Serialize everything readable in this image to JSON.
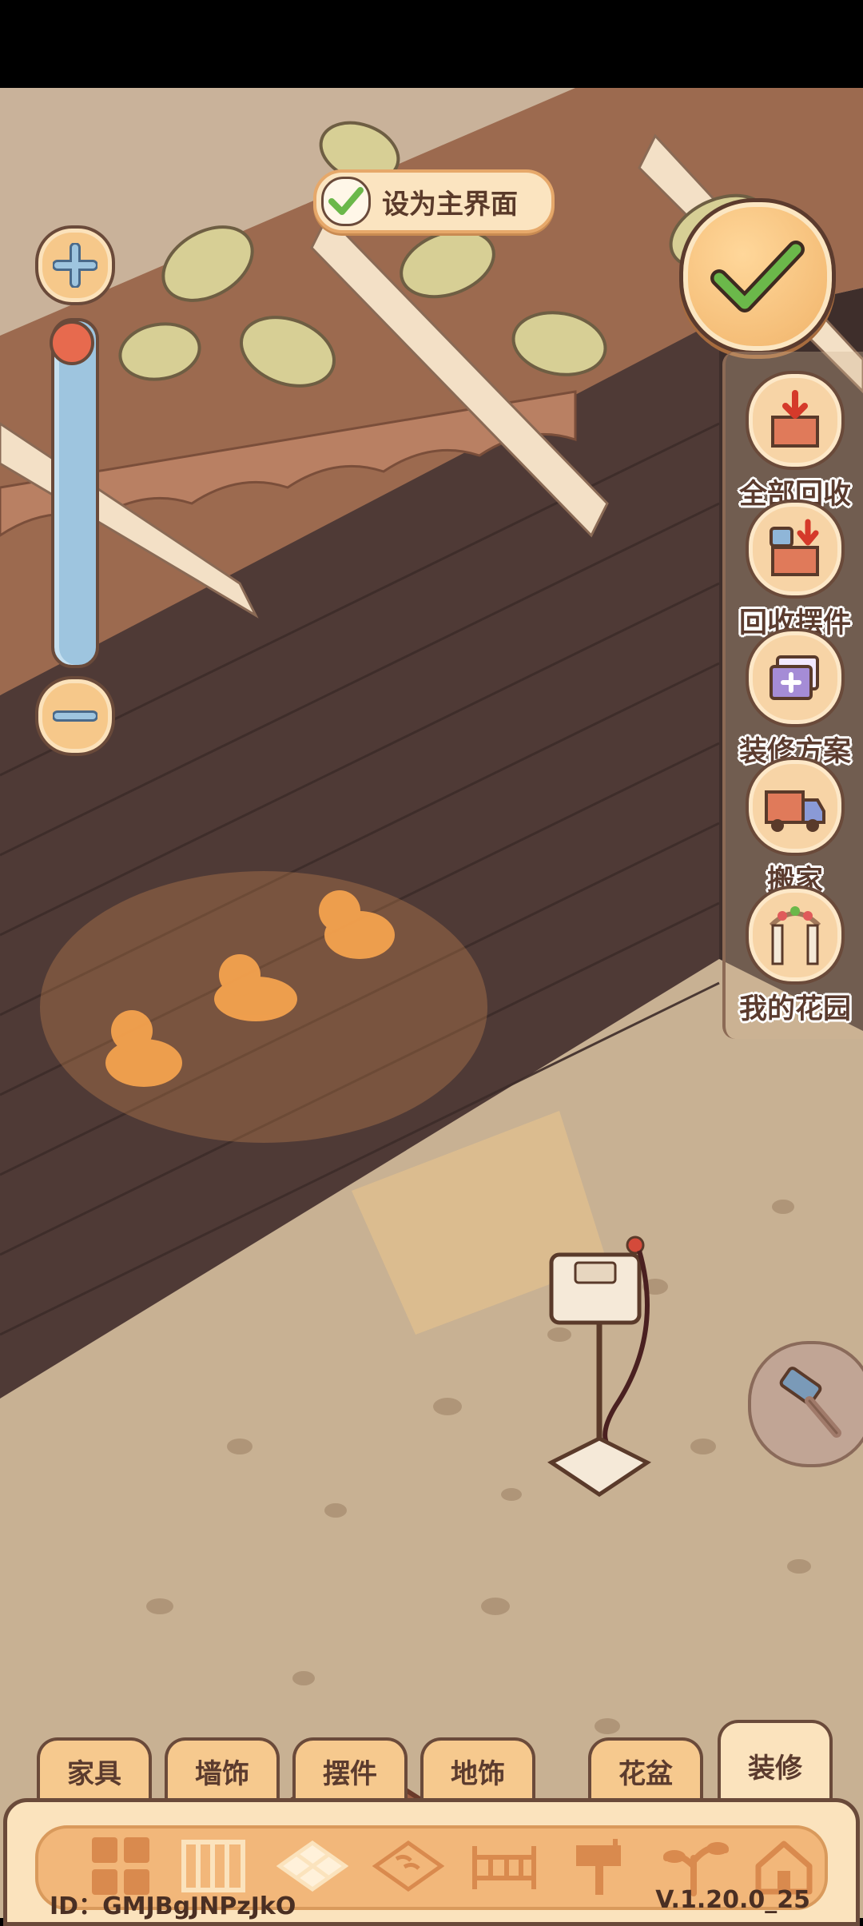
{
  "top_bar": {
    "set_main_label": "设为主界面"
  },
  "zoom": {
    "zoom_in": "plus-icon",
    "zoom_out": "minus-icon",
    "level": 0.03
  },
  "side_menu": [
    {
      "label": "全部回收",
      "icon": "recycle-all-icon"
    },
    {
      "label": "回收摆件",
      "icon": "recycle-ornament-icon"
    },
    {
      "label": "装修方案",
      "icon": "decor-plan-icon"
    },
    {
      "label": "搬家",
      "icon": "moving-truck-icon"
    },
    {
      "label": "我的花园",
      "icon": "garden-arch-icon"
    }
  ],
  "tabs": [
    {
      "label": "家具",
      "active": false
    },
    {
      "label": "墙饰",
      "active": false
    },
    {
      "label": "摆件",
      "active": false
    },
    {
      "label": "地饰",
      "active": false
    },
    {
      "label": "花盆",
      "active": false
    },
    {
      "label": "装修",
      "active": true
    }
  ],
  "categories": [
    "grid-icon",
    "wall-panel-icon",
    "floor-tile-icon",
    "roof-tile-icon",
    "fence-icon",
    "mailbox-icon",
    "plant-icon",
    "house-icon"
  ],
  "footer": {
    "id_text": "ID：GMJBgJNPzJkO",
    "version": "V.1.20.0_25"
  },
  "colors": {
    "accent": "#f6c98e",
    "outline": "#6a4a3a",
    "check_green": "#6bb84a",
    "slider_blue": "#9ec5df",
    "knob_red": "#e76a4e"
  }
}
